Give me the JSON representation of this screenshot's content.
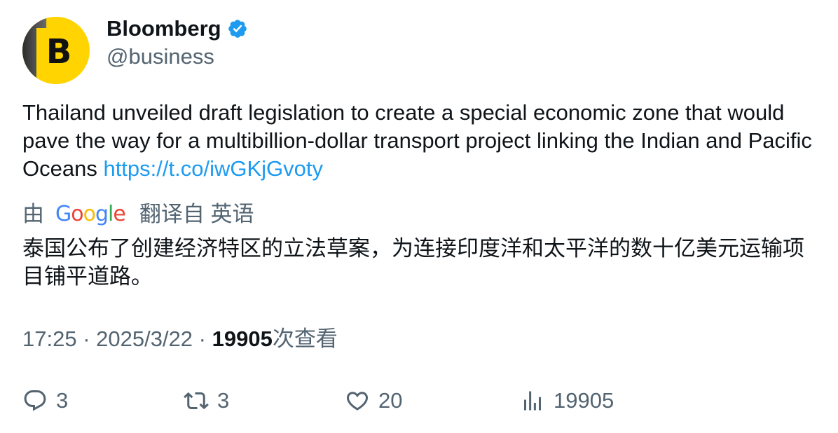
{
  "author": {
    "display_name": "Bloomberg",
    "handle": "@business",
    "avatar_letter": "B",
    "verified": true,
    "avatar_color": "#ffd400"
  },
  "tweet": {
    "text": "Thailand unveiled draft legislation to create a special economic zone that would pave the way for a multibillion-dollar transport project linking the Indian and Pacific Oceans ",
    "link": "https://t.co/iwGKjGvoty"
  },
  "translation": {
    "prefix": "由",
    "provider": "Google",
    "suffix": "翻译自 英语",
    "text": "泰国公布了创建经济特区的立法草案，为连接印度洋和太平洋的数十亿美元运输项目铺平道路。"
  },
  "meta": {
    "time": "17:25",
    "date": "2025/3/22",
    "views": "19905",
    "views_label": "次查看"
  },
  "actions": {
    "replies": "3",
    "retweets": "3",
    "likes": "20",
    "views": "19905"
  },
  "colors": {
    "link": "#1d9bf0",
    "secondary_text": "#536471",
    "primary_text": "#0f1419",
    "verified_badge": "#1d9bf0"
  },
  "icons": [
    "verified-badge-icon",
    "google-logo",
    "reply-icon",
    "retweet-icon",
    "like-icon",
    "views-icon"
  ]
}
